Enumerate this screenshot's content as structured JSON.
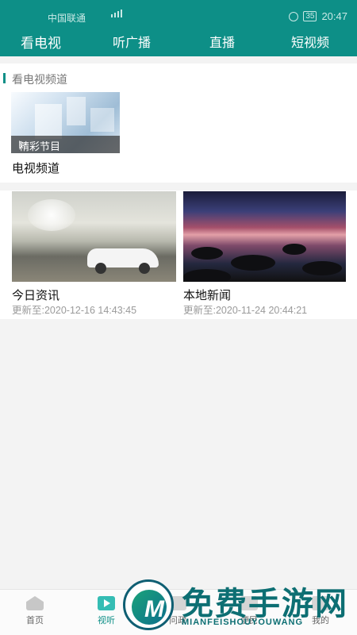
{
  "status_bar": {
    "carrier": "中国联通",
    "battery": "35",
    "time": "20:47"
  },
  "top_tabs": [
    {
      "label": "看电视",
      "active": true
    },
    {
      "label": "听广播",
      "active": false
    },
    {
      "label": "直播",
      "active": false
    },
    {
      "label": "短视频",
      "active": false
    }
  ],
  "channels_section": {
    "title": "看电视频道",
    "card": {
      "caption": "精彩节目",
      "name": "电视频道"
    }
  },
  "news_section": {
    "items": [
      {
        "title": "今日资讯",
        "updated": "更新至:2020-12-16 14:43:45"
      },
      {
        "title": "本地新闻",
        "updated": "更新至:2020-11-24 20:44:21"
      }
    ]
  },
  "bottom_nav": [
    {
      "label": "首页",
      "icon": "home-icon",
      "active": false
    },
    {
      "label": "视听",
      "icon": "play-icon",
      "active": true
    },
    {
      "label": "问政",
      "icon": "ask-icon",
      "active": false
    },
    {
      "label": "便民",
      "icon": "service-icon",
      "active": false
    },
    {
      "label": "我的",
      "icon": "user-icon",
      "active": false
    }
  ],
  "watermark": {
    "text": "免费手游网",
    "subtext": "MIANFEISHOUYOUWANG"
  },
  "colors": {
    "brand": "#0d8f87",
    "background": "#f3f3f3"
  }
}
